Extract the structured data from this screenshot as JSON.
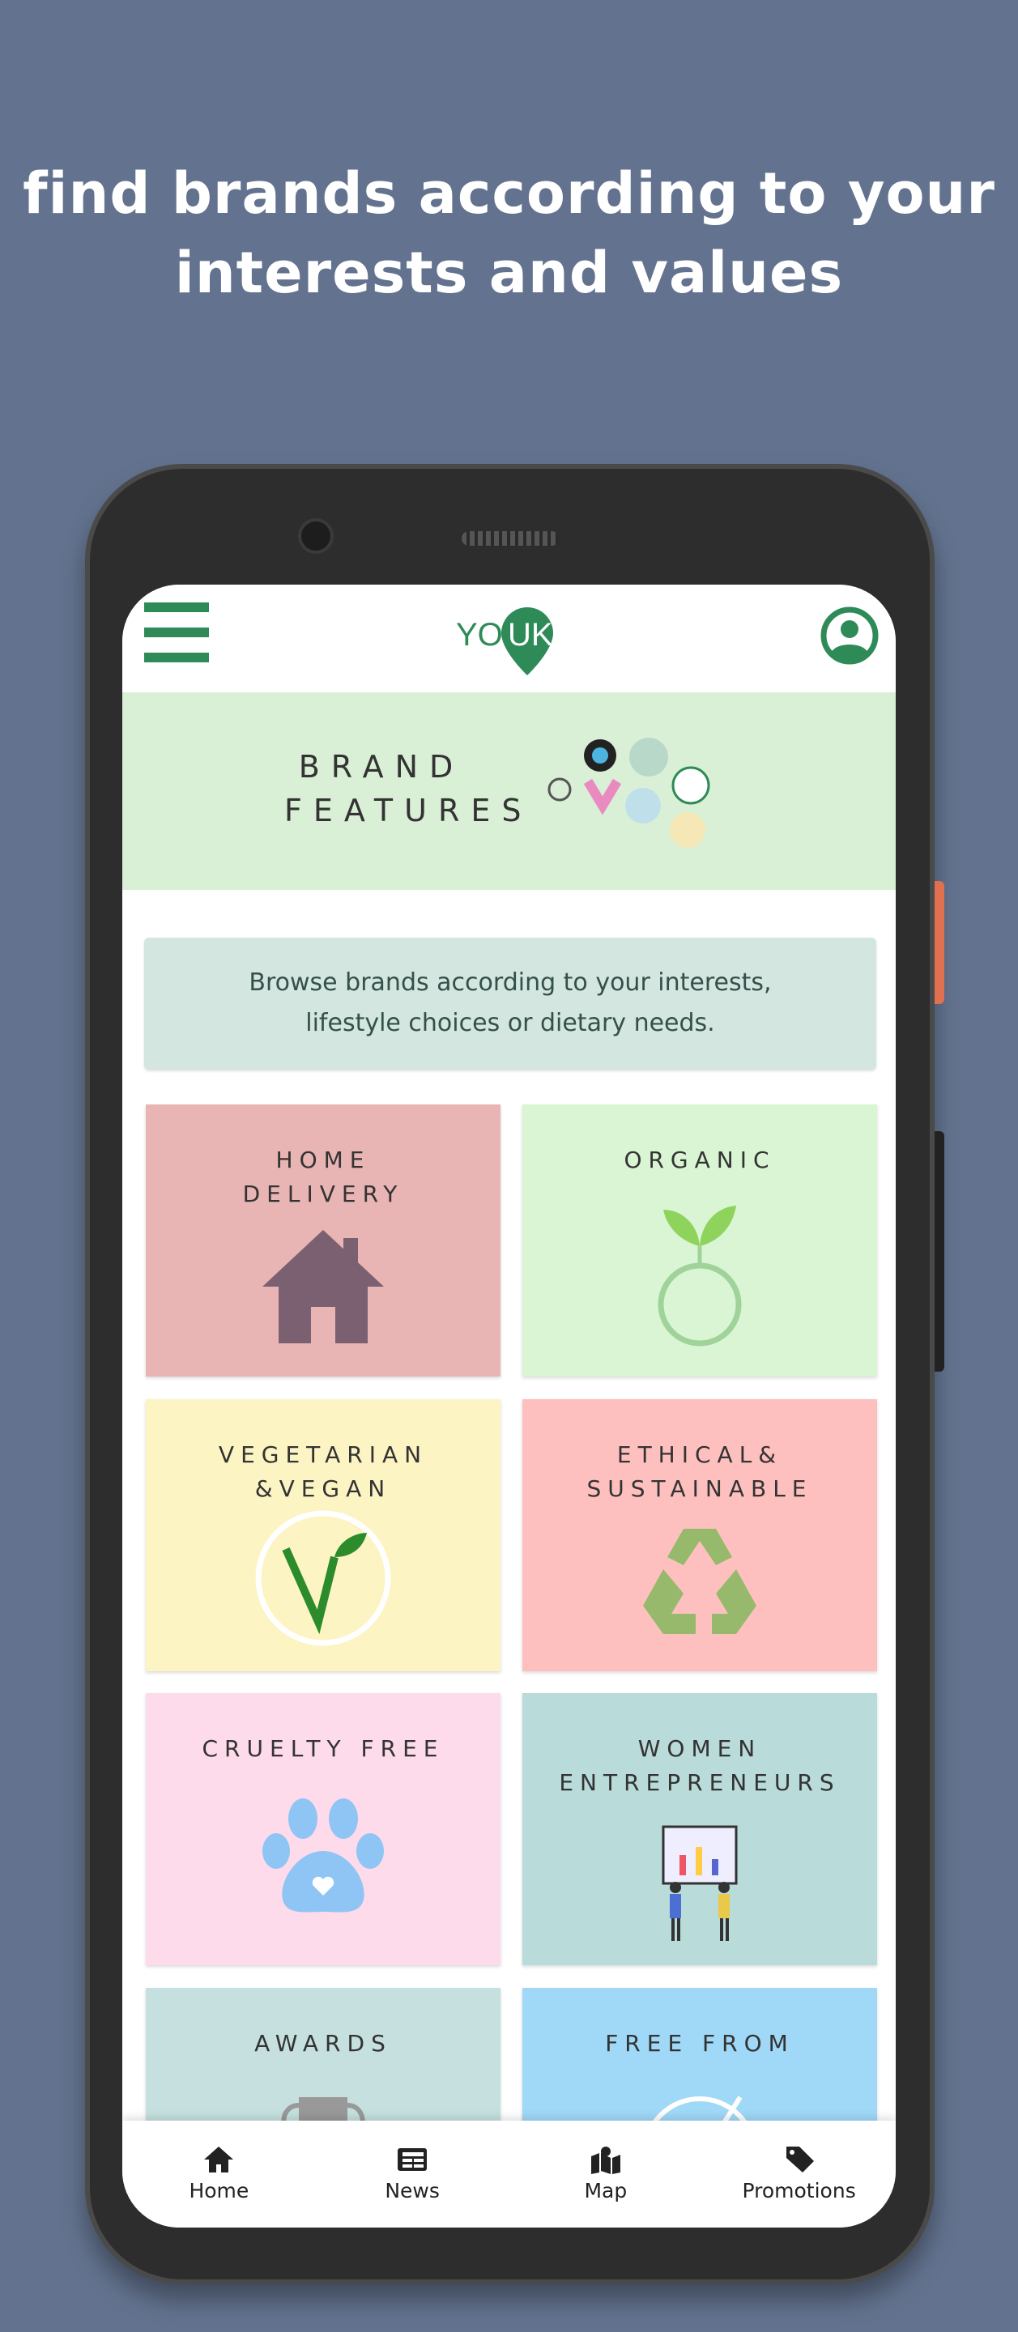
{
  "headline": {
    "line1": "find brands according to your",
    "line2": "interests and values"
  },
  "app": {
    "logo_text": {
      "a": "YO",
      "b": "UK"
    },
    "banner": {
      "line1": "BRAND",
      "line2": "FEATURES"
    },
    "info": {
      "line1": "Browse brands according to your interests,",
      "line2": "lifestyle choices or dietary needs."
    },
    "tiles": [
      {
        "line1": "HOME",
        "line2": "DELIVERY",
        "color": "#e8b4b4",
        "icon": "house-icon"
      },
      {
        "line1": "ORGANIC",
        "line2": "",
        "color": "#d9f5d3",
        "icon": "sprout-icon"
      },
      {
        "line1": "VEGETARIAN",
        "line2": "&VEGAN",
        "color": "#fdf4c4",
        "icon": "vegan-v-icon"
      },
      {
        "line1": "ETHICAL&",
        "line2": "SUSTAINABLE",
        "color": "#fec0bf",
        "icon": "recycle-icon"
      },
      {
        "line1": "CRUELTY  FREE",
        "line2": "",
        "color": "#fddbea",
        "icon": "paw-icon"
      },
      {
        "line1": "WOMEN",
        "line2": "ENTREPRENEURS",
        "color": "#b9dbd9",
        "icon": "women-presentation-icon"
      },
      {
        "line1": "AWARDS",
        "line2": "",
        "color": "#c5e0df",
        "icon": "trophy-icon"
      },
      {
        "line1": "FREE  FROM",
        "line2": "",
        "color": "#a0d8f8",
        "icon": "free-from-icon"
      }
    ],
    "nav": [
      {
        "label": "Home",
        "icon": "home-icon"
      },
      {
        "label": "News",
        "icon": "newspaper-icon"
      },
      {
        "label": "Map",
        "icon": "map-icon"
      },
      {
        "label": "Promotions",
        "icon": "tag-icon"
      }
    ],
    "accent": "#2e8b57"
  }
}
